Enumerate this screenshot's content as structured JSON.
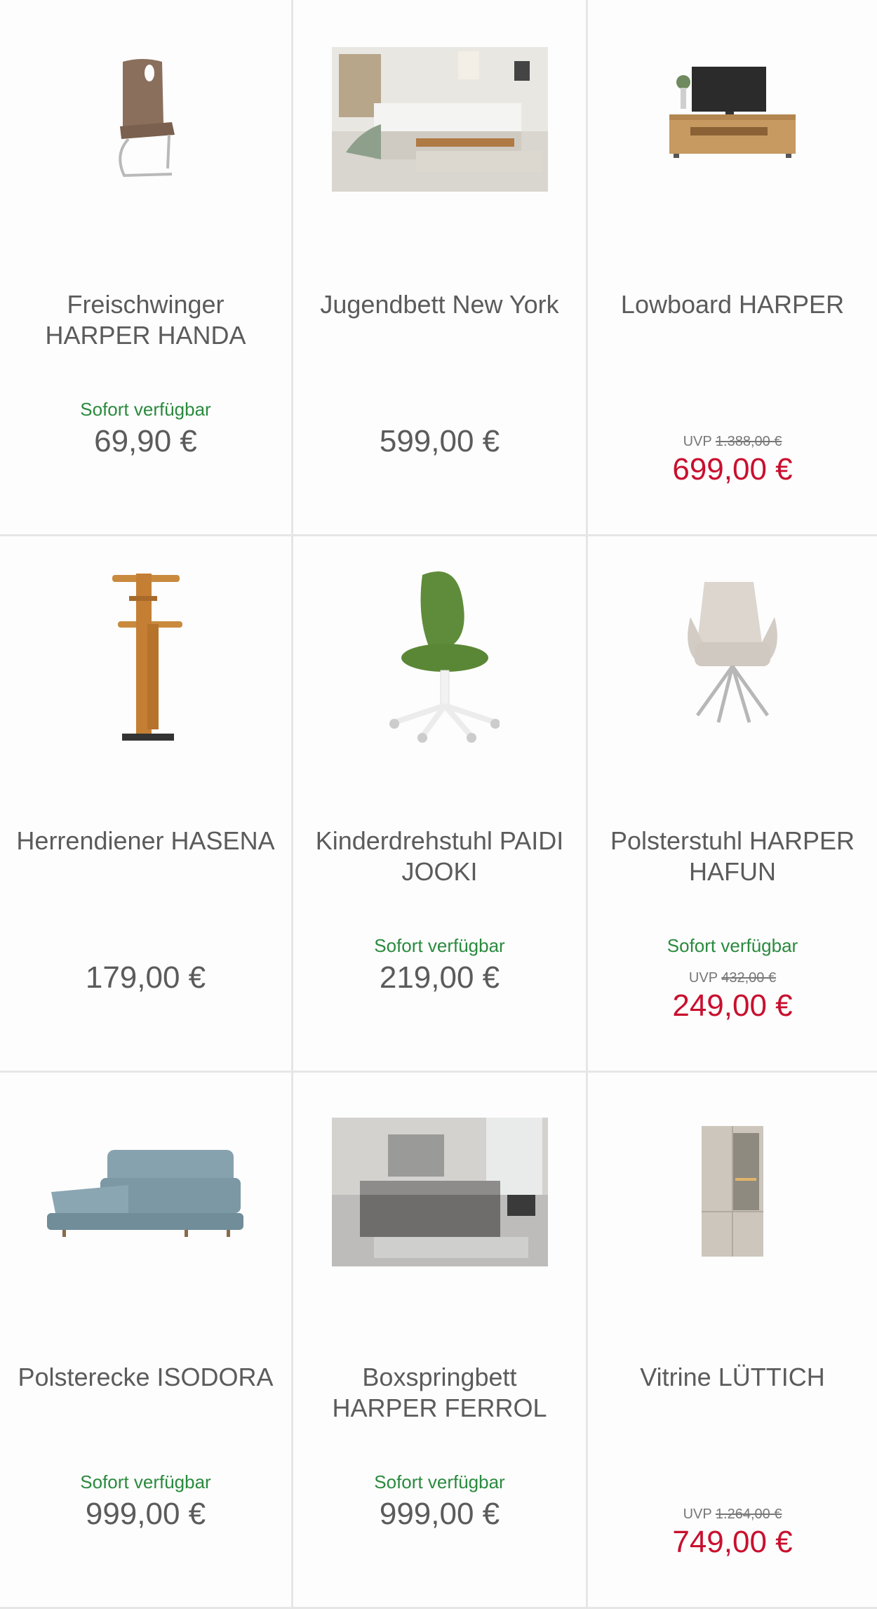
{
  "products": [
    {
      "name": "Freischwinger HARPER HANDA",
      "availability": "Sofort verfügbar",
      "uvp_label": "",
      "uvp_price": "",
      "price": "69,90 €",
      "image": "cantilever-chair-image"
    },
    {
      "name": "Jugendbett New York",
      "availability": "",
      "uvp_label": "",
      "uvp_price": "",
      "price": "599,00 €",
      "image": "youth-bed-image"
    },
    {
      "name": "Lowboard HARPER",
      "availability": "",
      "uvp_label": "UVP",
      "uvp_price": "1.388,00 €",
      "price": "699,00 €",
      "image": "tv-lowboard-image"
    },
    {
      "name": "Herrendiener HASENA",
      "availability": "",
      "uvp_label": "",
      "uvp_price": "",
      "price": "179,00 €",
      "image": "valet-stand-image"
    },
    {
      "name": "Kinderdrehstuhl PAIDI JOOKI",
      "availability": "Sofort verfügbar",
      "uvp_label": "",
      "uvp_price": "",
      "price": "219,00 €",
      "image": "kids-swivel-chair-image"
    },
    {
      "name": "Polsterstuhl HARPER HAFUN",
      "availability": "Sofort verfügbar",
      "uvp_label": "UVP",
      "uvp_price": "432,00 €",
      "price": "249,00 €",
      "image": "upholstered-chair-image"
    },
    {
      "name": "Polsterecke ISODORA",
      "availability": "Sofort verfügbar",
      "uvp_label": "",
      "uvp_price": "",
      "price": "999,00 €",
      "image": "corner-sofa-image"
    },
    {
      "name": "Boxspringbett HARPER FERROL",
      "availability": "Sofort verfügbar",
      "uvp_label": "",
      "uvp_price": "",
      "price": "999,00 €",
      "image": "boxspring-bed-image"
    },
    {
      "name": "Vitrine LÜTTICH",
      "availability": "",
      "uvp_label": "UVP",
      "uvp_price": "1.264,00 €",
      "price": "749,00 €",
      "image": "display-cabinet-image"
    }
  ],
  "colors": {
    "availability": "#2a8a3e",
    "sale_price": "#c8102e",
    "text": "#5b5b5b",
    "divider": "#e6e6e6"
  }
}
